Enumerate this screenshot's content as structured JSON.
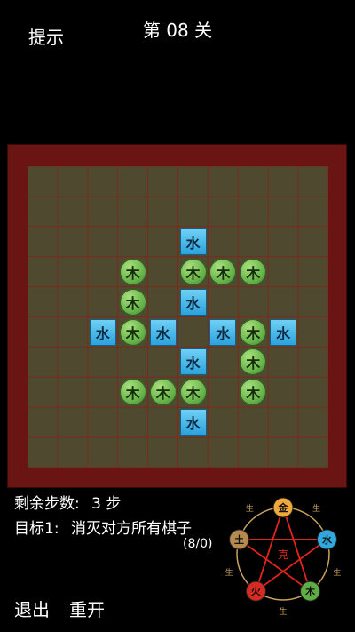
{
  "header": {
    "hint_label": "提示",
    "level_title": "第 08 关"
  },
  "board": {
    "rows": 10,
    "cols": 10,
    "pieces": [
      {
        "r": 2,
        "c": 5,
        "type": "water",
        "label": "水"
      },
      {
        "r": 3,
        "c": 3,
        "type": "wood",
        "label": "木"
      },
      {
        "r": 3,
        "c": 5,
        "type": "wood",
        "label": "木"
      },
      {
        "r": 3,
        "c": 6,
        "type": "wood",
        "label": "木"
      },
      {
        "r": 3,
        "c": 7,
        "type": "wood",
        "label": "木"
      },
      {
        "r": 4,
        "c": 3,
        "type": "wood",
        "label": "木"
      },
      {
        "r": 4,
        "c": 5,
        "type": "water",
        "label": "水"
      },
      {
        "r": 5,
        "c": 2,
        "type": "water",
        "label": "水"
      },
      {
        "r": 5,
        "c": 3,
        "type": "wood",
        "label": "木"
      },
      {
        "r": 5,
        "c": 4,
        "type": "water",
        "label": "水"
      },
      {
        "r": 5,
        "c": 6,
        "type": "water",
        "label": "水"
      },
      {
        "r": 5,
        "c": 7,
        "type": "wood",
        "label": "木"
      },
      {
        "r": 5,
        "c": 8,
        "type": "water",
        "label": "水"
      },
      {
        "r": 6,
        "c": 5,
        "type": "water",
        "label": "水"
      },
      {
        "r": 6,
        "c": 7,
        "type": "wood",
        "label": "木"
      },
      {
        "r": 7,
        "c": 3,
        "type": "wood",
        "label": "木"
      },
      {
        "r": 7,
        "c": 4,
        "type": "wood",
        "label": "木"
      },
      {
        "r": 7,
        "c": 5,
        "type": "wood",
        "label": "木"
      },
      {
        "r": 7,
        "c": 7,
        "type": "wood",
        "label": "木"
      },
      {
        "r": 8,
        "c": 5,
        "type": "water",
        "label": "水"
      }
    ]
  },
  "status": {
    "steps_label": "剩余步数:",
    "steps_value": "3 步",
    "goal_label": "目标1:",
    "goal_text": "消灭对方所有棋子",
    "progress": "(8/0)"
  },
  "footer": {
    "exit_label": "退出",
    "restart_label": "重开"
  },
  "cycle": {
    "nodes": [
      {
        "label": "金",
        "color": "#f2a93b"
      },
      {
        "label": "水",
        "color": "#2fa9df"
      },
      {
        "label": "木",
        "color": "#5fae45"
      },
      {
        "label": "火",
        "color": "#d62a22"
      },
      {
        "label": "土",
        "color": "#b58a4c"
      }
    ],
    "center_label": "克",
    "generate_label": "生",
    "overcome_color": "#e0241b",
    "generate_color": "#c9a25e"
  }
}
